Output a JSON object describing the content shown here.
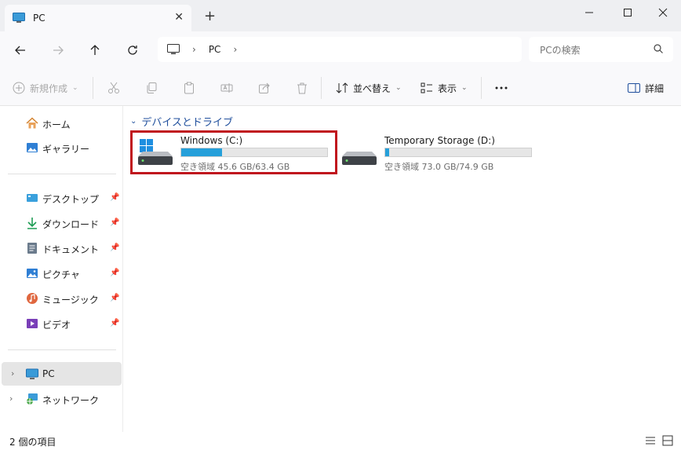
{
  "tab": {
    "title": "PC"
  },
  "addressbar": {
    "crumb": "PC"
  },
  "search": {
    "placeholder": "PCの検索"
  },
  "commands": {
    "new": "新規作成",
    "sort": "並べ替え",
    "view": "表示",
    "details": "詳細"
  },
  "sidebar": {
    "home": "ホーム",
    "gallery": "ギャラリー",
    "desktop": "デスクトップ",
    "downloads": "ダウンロード",
    "documents": "ドキュメント",
    "pictures": "ピクチャ",
    "music": "ミュージック",
    "videos": "ビデオ",
    "pc": "PC",
    "network": "ネットワーク"
  },
  "main": {
    "group_title": "デバイスとドライブ",
    "drives": [
      {
        "name": "Windows (C:)",
        "free": "空き領域 45.6 GB/63.4 GB",
        "used_fraction": 0.281
      },
      {
        "name": "Temporary Storage (D:)",
        "free": "空き領域 73.0 GB/74.9 GB",
        "used_fraction": 0.025
      }
    ]
  },
  "status": {
    "count": "2 個の項目"
  },
  "colors": {
    "accent": "#26a0da",
    "highlight": "#c0151e",
    "group_header": "#1f4e9c"
  }
}
